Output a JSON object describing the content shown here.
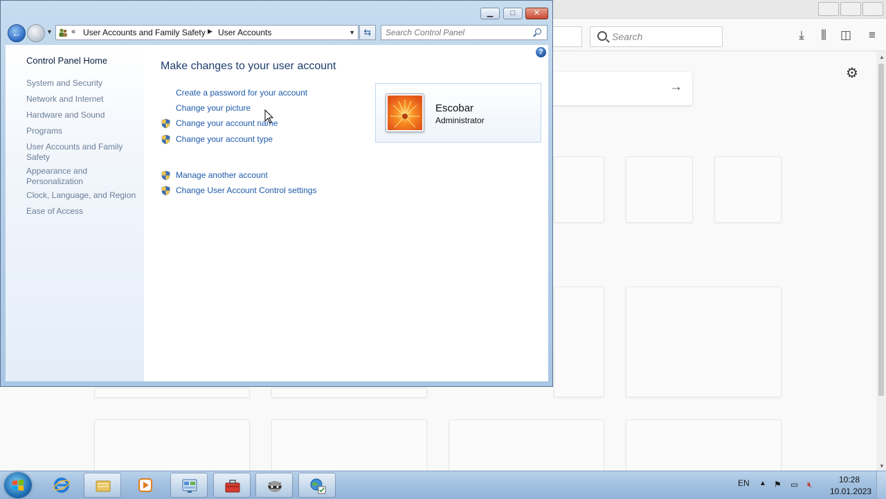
{
  "browser": {
    "search_placeholder": "Search",
    "toolbar_icons": [
      "downloads-icon",
      "library-icon",
      "sidebar-icon",
      "menu-icon"
    ],
    "settings_icon": "gear-icon"
  },
  "window": {
    "breadcrumb": [
      "User Accounts and Family Safety",
      "User Accounts"
    ],
    "search_placeholder": "Search Control Panel"
  },
  "left_pane": {
    "home": "Control Panel Home",
    "items": [
      "System and Security",
      "Network and Internet",
      "Hardware and Sound",
      "Programs",
      "User Accounts and Family Safety",
      "Appearance and Personalization",
      "Clock, Language, and Region",
      "Ease of Access"
    ]
  },
  "main": {
    "title": "Make changes to your user account",
    "tasks": [
      "Create a password for your account",
      "Change your picture",
      "Change your account name",
      "Change your account type"
    ],
    "other_tasks": [
      "Manage another account",
      "Change User Account Control settings"
    ]
  },
  "account": {
    "name": "Escobar",
    "role": "Administrator"
  },
  "taskbar": {
    "language": "EN",
    "time": "10:28",
    "date": "10.01.2023",
    "pinned": [
      "internet-explorer-icon",
      "file-explorer-icon",
      "media-player-icon",
      "control-panel-icon",
      "toolbox-icon",
      "raccoon-app-icon",
      "network-globe-icon"
    ]
  },
  "colors": {
    "link": "#1e5aa8",
    "title": "#1e3c6e",
    "left_pane_text": "#6a7d96"
  }
}
